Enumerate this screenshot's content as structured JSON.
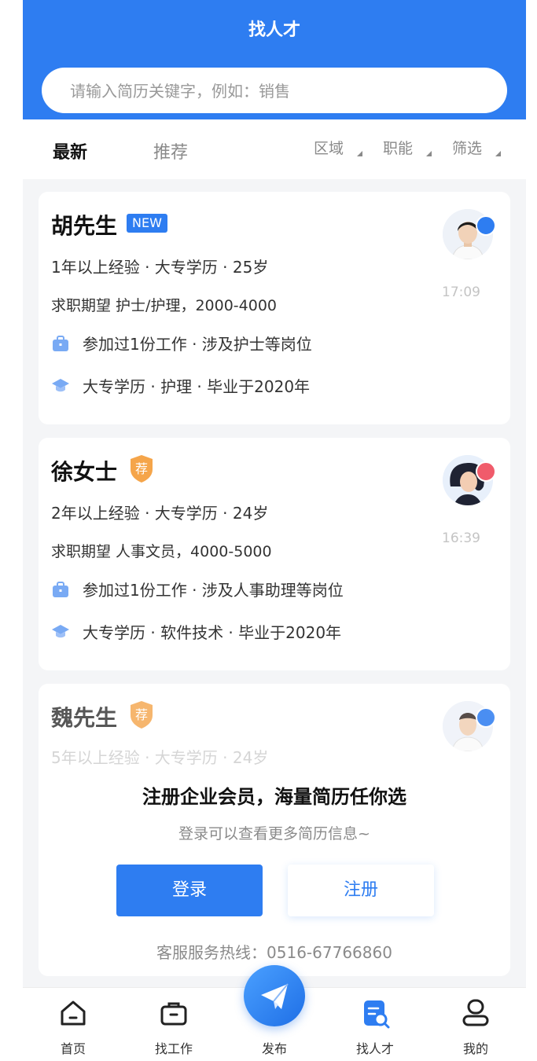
{
  "header": {
    "title": "找人才"
  },
  "search": {
    "placeholder": "请输入简历关键字，例如：销售"
  },
  "tabs": [
    {
      "label": "最新",
      "active": true
    },
    {
      "label": "推荐",
      "active": false
    }
  ],
  "filters": [
    {
      "label": "区域"
    },
    {
      "label": "职能"
    },
    {
      "label": "筛选"
    }
  ],
  "resumes": [
    {
      "name": "胡先生",
      "badge": "NEW",
      "meta": "1年以上经验 · 大专学历 · 25岁",
      "expect": "求职期望 护士/护理，2000-4000",
      "work": "参加过1份工作 · 涉及护士等岗位",
      "edu": "大专学历 · 护理 · 毕业于2020年",
      "time": "17:09",
      "gender": "male"
    },
    {
      "name": "徐女士",
      "badge": "荐",
      "meta": "2年以上经验 · 大专学历 · 24岁",
      "expect": "求职期望 人事文员，4000-5000",
      "work": "参加过1份工作 · 涉及人事助理等岗位",
      "edu": "大专学历 · 软件技术 · 毕业于2020年",
      "time": "16:39",
      "gender": "female"
    },
    {
      "name": "魏先生",
      "badge": "荐",
      "meta": "5年以上经验 · 大专学历 · 24岁",
      "gender": "male"
    }
  ],
  "promo": {
    "title": "注册企业会员，海量简历任你选",
    "subtitle": "登录可以查看更多简历信息~",
    "login_label": "登录",
    "register_label": "注册",
    "hotline": "客服服务热线：0516-67766860"
  },
  "bottom_nav": [
    {
      "label": "首页",
      "icon": "home-icon"
    },
    {
      "label": "找工作",
      "icon": "briefcase-icon"
    },
    {
      "label": "发布",
      "icon": "send-icon"
    },
    {
      "label": "找人才",
      "icon": "talent-search-icon",
      "active": true
    },
    {
      "label": "我的",
      "icon": "profile-icon"
    }
  ],
  "colors": {
    "primary": "#2e7df1",
    "recommend_badge": "#f5a54a",
    "female": "#f05b6b"
  }
}
